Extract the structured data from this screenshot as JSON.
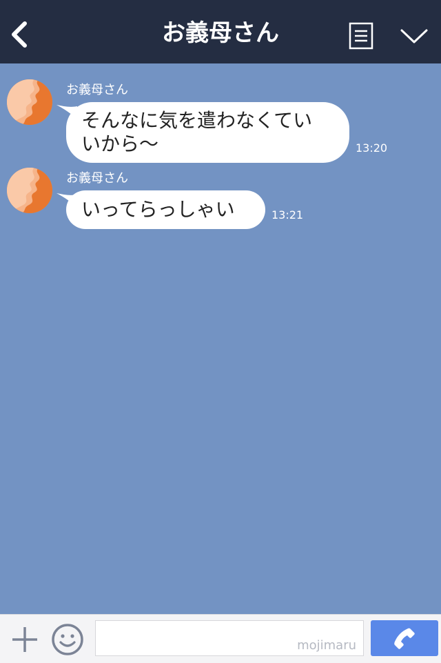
{
  "header": {
    "title": "お義母さん",
    "back_icon": "chevron-left-icon",
    "menu_icon": "document-menu-icon",
    "collapse_icon": "chevron-down-icon"
  },
  "messages": [
    {
      "sender": "お義母さん",
      "lines": [
        "そんなに気を遣わなくてい",
        "いから〜"
      ],
      "time": "13:20"
    },
    {
      "sender": "お義母さん",
      "lines": [
        "いってらっしゃい"
      ],
      "time": "13:21"
    }
  ],
  "composer": {
    "input_value": "",
    "watermark": "mojimaru",
    "plus_icon": "plus-icon",
    "emoji_icon": "smiley-icon",
    "call_icon": "phone-icon"
  },
  "colors": {
    "header_bg": "#242d42",
    "chat_bg": "#7393c3",
    "bubble_bg": "#ffffff",
    "call_button": "#5a88e8"
  }
}
